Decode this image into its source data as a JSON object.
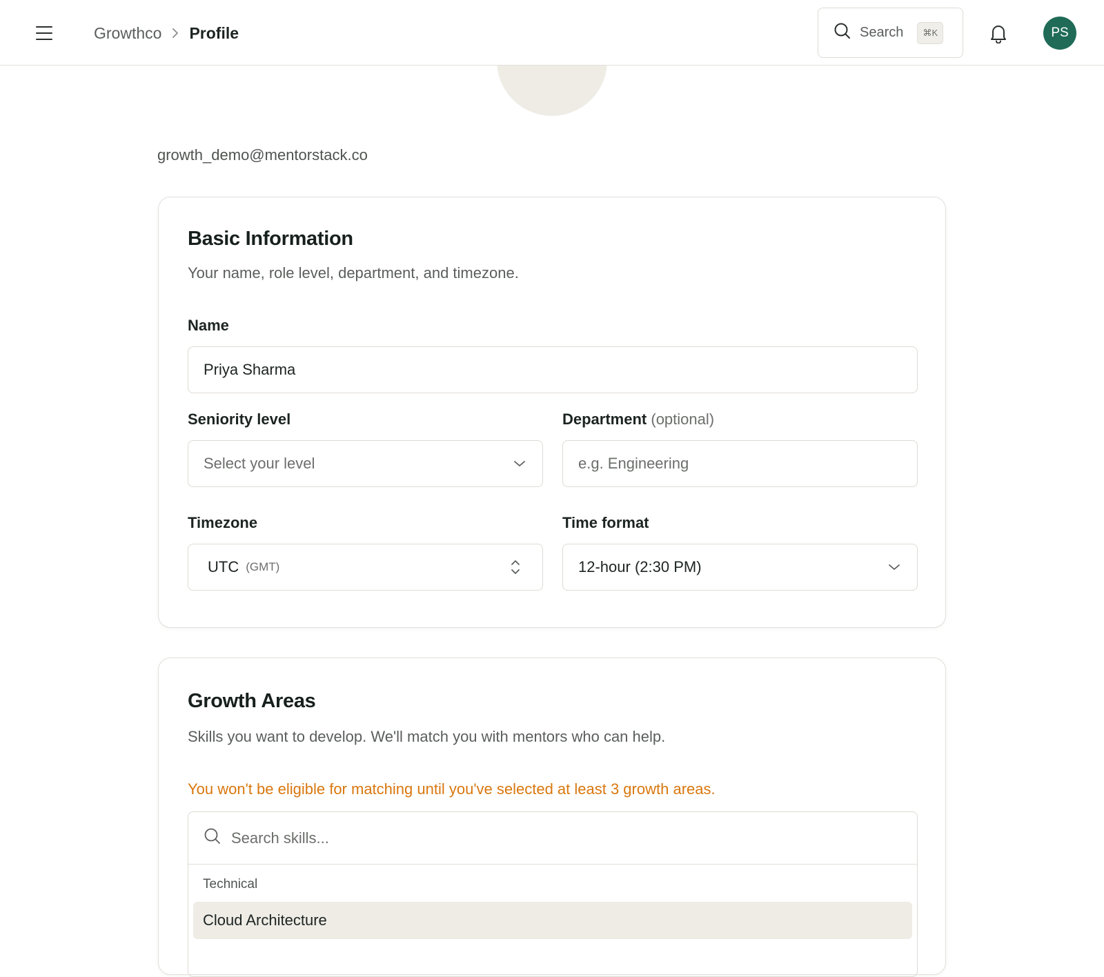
{
  "header": {
    "breadcrumb_parent": "Growthco",
    "breadcrumb_current": "Profile",
    "search_label": "Search",
    "search_shortcut": "⌘K",
    "avatar_initials": "PS"
  },
  "profile": {
    "email": "growth_demo@mentorstack.co"
  },
  "basic_info": {
    "title": "Basic Information",
    "description": "Your name, role level, department, and timezone.",
    "name_label": "Name",
    "name_value": "Priya Sharma",
    "seniority_label": "Seniority level",
    "seniority_placeholder": "Select your level",
    "department_label": "Department",
    "department_optional": "(optional)",
    "department_placeholder": "e.g. Engineering",
    "timezone_label": "Timezone",
    "timezone_value": "UTC",
    "timezone_sub": "(GMT)",
    "time_format_label": "Time format",
    "time_format_value": "12-hour (2:30 PM)"
  },
  "growth_areas": {
    "title": "Growth Areas",
    "description": "Skills you want to develop. We'll match you with mentors who can help.",
    "warning": "You won't be eligible for matching until you've selected at least 3 growth areas.",
    "search_placeholder": "Search skills...",
    "groups": [
      {
        "label": "Technical",
        "options": [
          "Cloud Architecture"
        ]
      }
    ]
  },
  "colors": {
    "accent_green": "#1f6b57",
    "warning_orange": "#d9770e",
    "option_highlight": "#efece6"
  },
  "icons": {
    "menu": "hamburger-icon",
    "breadcrumb_separator": "chevron-right-icon",
    "search": "search-icon",
    "notifications": "bell-icon",
    "select": "chevron-down-icon",
    "timezone_select": "chevron-up-down-icon"
  }
}
